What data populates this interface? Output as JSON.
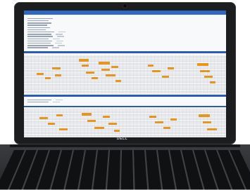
{
  "device": {
    "brand_label": "DELL"
  },
  "app": {
    "title": "",
    "user": ""
  },
  "colors": {
    "header_blue": "#2d68c4",
    "rule_blue": "#2c5ab8",
    "highlight_orange": "#e8951f"
  },
  "info_rows": 14,
  "grid_panels": 2
}
